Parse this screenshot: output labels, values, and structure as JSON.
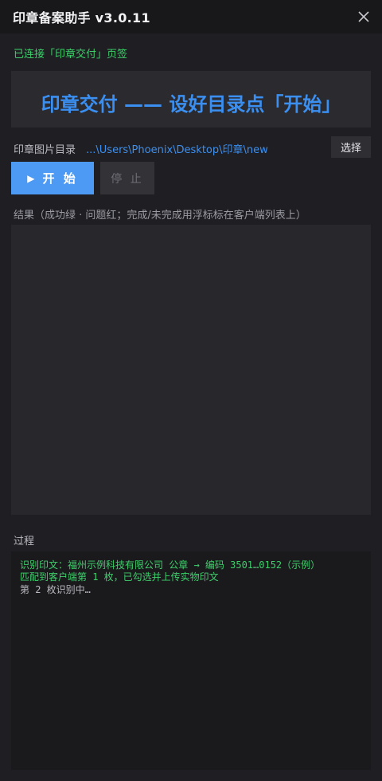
{
  "window": {
    "title": "印章备案助手 v3.0.11",
    "close_icon": "close-icon"
  },
  "status": {
    "text": "已连接「印章交付」页签",
    "color": "#3ecf6b"
  },
  "banner": {
    "text": "印章交付 —— 设好目录点「开始」",
    "color": "#3b8ff0"
  },
  "directory": {
    "label": "印章图片目录",
    "path": "...\\Users\\Phoenix\\Desktop\\印章\\new",
    "choose_label": "选择"
  },
  "controls": {
    "start_icon": "play-icon",
    "start_label": "开 始",
    "stop_label": "停 止",
    "accent": "#4d9af5"
  },
  "results": {
    "label": "结果（成功绿 · 问题红；完成/未完成用浮标标在客户端列表上）"
  },
  "process": {
    "label": "过程",
    "lines": [
      {
        "text": "识别印文：福州示例科技有限公司 公章 → 编码 3501…0152（示例）",
        "status": "success"
      },
      {
        "text": "匹配到客户端第 1 枚，已勾选并上传实物印文",
        "status": "success"
      },
      {
        "text": "第 2 枚识别中…",
        "status": "pending"
      }
    ]
  }
}
